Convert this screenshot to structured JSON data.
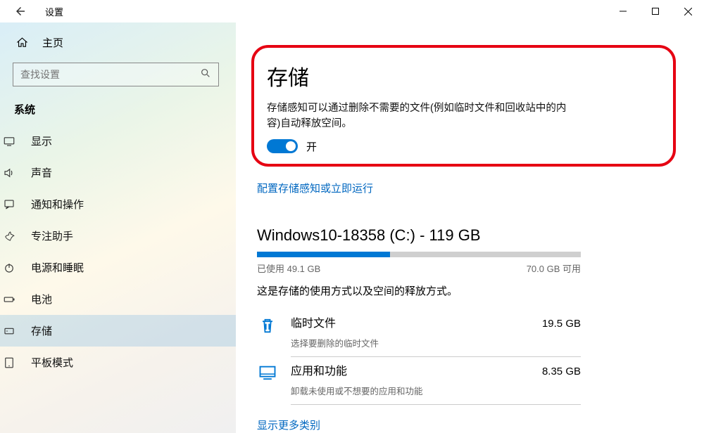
{
  "app_title": "设置",
  "home_label": "主页",
  "search_placeholder": "查找设置",
  "section_title": "系统",
  "nav_items": [
    {
      "key": "display",
      "label": "显示"
    },
    {
      "key": "sound",
      "label": "声音"
    },
    {
      "key": "notifications",
      "label": "通知和操作"
    },
    {
      "key": "focus",
      "label": "专注助手"
    },
    {
      "key": "power",
      "label": "电源和睡眠"
    },
    {
      "key": "battery",
      "label": "电池"
    },
    {
      "key": "storage",
      "label": "存储"
    },
    {
      "key": "tablet",
      "label": "平板模式"
    }
  ],
  "page_title": "存储",
  "storage_sense_desc": "存储感知可以通过删除不需要的文件(例如临时文件和回收站中的内容)自动释放空间。",
  "toggle_state": "开",
  "configure_link": "配置存储感知或立即运行",
  "drive": {
    "title": "Windows10-18358 (C:) - 119 GB",
    "used_label": "已使用 49.1 GB",
    "free_label": "70.0 GB 可用",
    "fill_percent": 41,
    "desc": "这是存储的使用方式以及空间的释放方式。"
  },
  "categories": [
    {
      "key": "temp",
      "name": "临时文件",
      "size": "19.5 GB",
      "sub": "选择要删除的临时文件"
    },
    {
      "key": "apps",
      "name": "应用和功能",
      "size": "8.35 GB",
      "sub": "卸载未使用或不想要的应用和功能"
    }
  ],
  "more_link": "显示更多类别"
}
